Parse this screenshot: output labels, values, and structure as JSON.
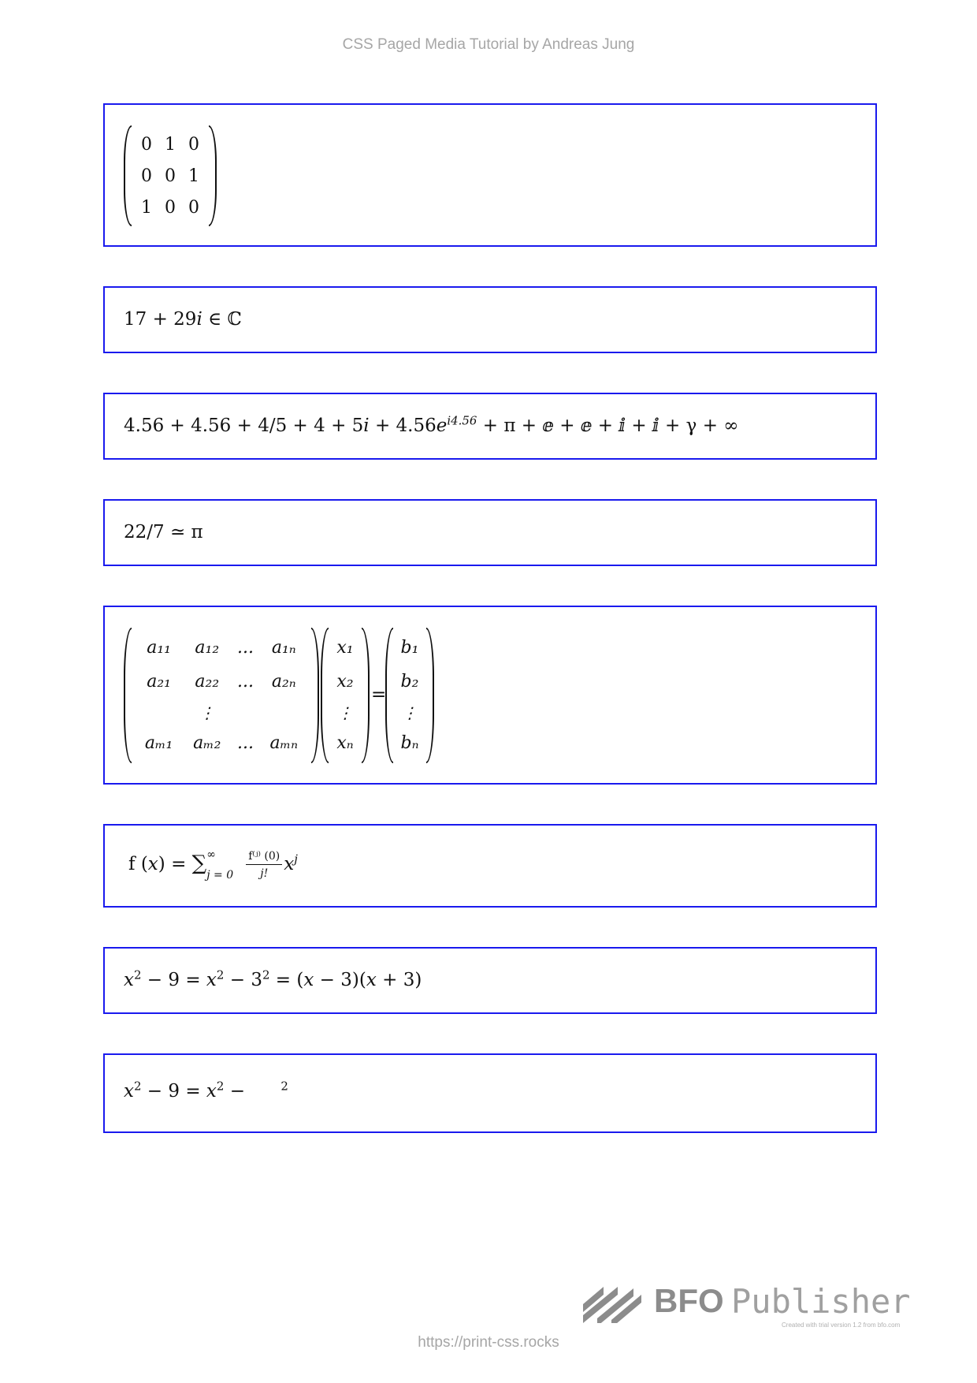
{
  "header": {
    "title": "CSS Paged Media Tutorial by Andreas Jung"
  },
  "footer": {
    "url": "https://print-css.rocks"
  },
  "logo": {
    "brand": "BFO",
    "product": "Publisher",
    "note": "Created with trial version 1.2 from bfo.com",
    "icon": "bfo-stripes-icon",
    "color": "#8c8c8c"
  },
  "accent_color": "#1a1aee",
  "formulas": {
    "permutation_matrix": [
      [
        "0",
        "1",
        "0"
      ],
      [
        "0",
        "0",
        "1"
      ],
      [
        "1",
        "0",
        "0"
      ]
    ],
    "complex": {
      "left": "17 + 29",
      "imag": "i",
      "rest": " ∈ ℂ"
    },
    "constants": {
      "part1": "4.56 + 4.56 + 4/5 + 4 + 5",
      "imag": "i",
      "part2": " + 4.56",
      "e": "e",
      "exp": "i4.56",
      "part3": " + π + ⅇ + ⅇ + ⅈ + ⅈ + γ + ∞"
    },
    "approx": {
      "text": "22/7 ≃ π"
    },
    "linear_system": {
      "A": [
        [
          "a₁₁",
          "a₁₂",
          "...",
          "a₁ₙ"
        ],
        [
          "a₂₁",
          "a₂₂",
          "...",
          "a₂ₙ"
        ],
        [
          "",
          "⋮",
          "",
          ""
        ],
        [
          "aₘ₁",
          "aₘ₂",
          "...",
          "aₘₙ"
        ]
      ],
      "x": [
        "x₁",
        "x₂",
        "⋮",
        "xₙ"
      ],
      "equals": "=",
      "b": [
        "b₁",
        "b₂",
        "⋮",
        "bₙ"
      ]
    },
    "taylor": {
      "lhs": "f (",
      "var": "x",
      "rhs_eq": ") = ",
      "sigma": "∑",
      "upper": "∞",
      "lower": "j = 0",
      "num": "f⁽ʲ⁾ (0)",
      "den": "j!",
      "x": "x",
      "pow": "j"
    },
    "factoring": {
      "p1": "x",
      "s1": "2",
      "p2": " − 9 = ",
      "p3": "x",
      "s2": "2",
      "p4": " − 3",
      "s3": "2",
      "p5": " = (",
      "p6": "x",
      "p7": " − 3)(",
      "p8": "x",
      "p9": " + 3)"
    },
    "factoring_partial": {
      "p1": "x",
      "s1": "2",
      "p2": " − 9 = ",
      "p3": "x",
      "s2": "2",
      "p4": " − ",
      "s3": "2"
    }
  }
}
